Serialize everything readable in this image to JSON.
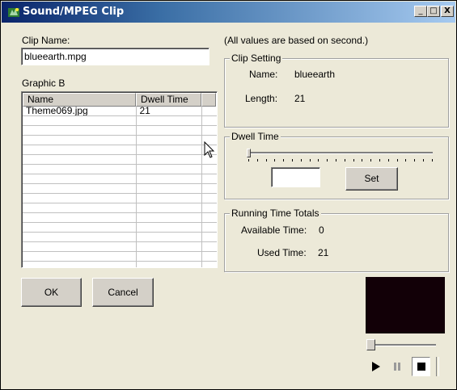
{
  "window": {
    "title": "Sound/MPEG Clip",
    "minimize_symbol": "_",
    "maximize_symbol": "□",
    "close_symbol": "X"
  },
  "clip_name": {
    "label": "Clip Name:",
    "value": "blueearth.mpg"
  },
  "graphic": {
    "label": "Graphic B",
    "columns": [
      "Name",
      "Dwell Time"
    ],
    "rows": [
      [
        "Theme069.jpg",
        "21"
      ],
      [
        "",
        ""
      ],
      [
        "",
        ""
      ],
      [
        "",
        ""
      ],
      [
        "",
        ""
      ],
      [
        "",
        ""
      ],
      [
        "",
        ""
      ],
      [
        "",
        ""
      ],
      [
        "",
        ""
      ],
      [
        "",
        ""
      ],
      [
        "",
        ""
      ],
      [
        "",
        ""
      ],
      [
        "",
        ""
      ],
      [
        "",
        ""
      ],
      [
        "",
        ""
      ],
      [
        "",
        ""
      ],
      [
        "",
        ""
      ]
    ]
  },
  "note": "(All values are based on second.)",
  "clip_setting": {
    "label": "Clip Setting",
    "name_label": "Name:",
    "name_value": "blueearth",
    "length_label": "Length:",
    "length_value": "21"
  },
  "dwell_time": {
    "label": "Dwell Time",
    "value": "",
    "set_label": "Set",
    "slider_level": 0
  },
  "running_totals": {
    "label": "Running Time Totals",
    "available_label": "Available Time:",
    "available_value": "0",
    "used_label": "Used Time:",
    "used_value": "21"
  },
  "buttons": {
    "ok": "OK",
    "cancel": "Cancel"
  },
  "player": {
    "seek_level": 0,
    "play_icon": "play-icon",
    "pause_icon": "pause-icon",
    "stop_icon": "stop-icon"
  }
}
